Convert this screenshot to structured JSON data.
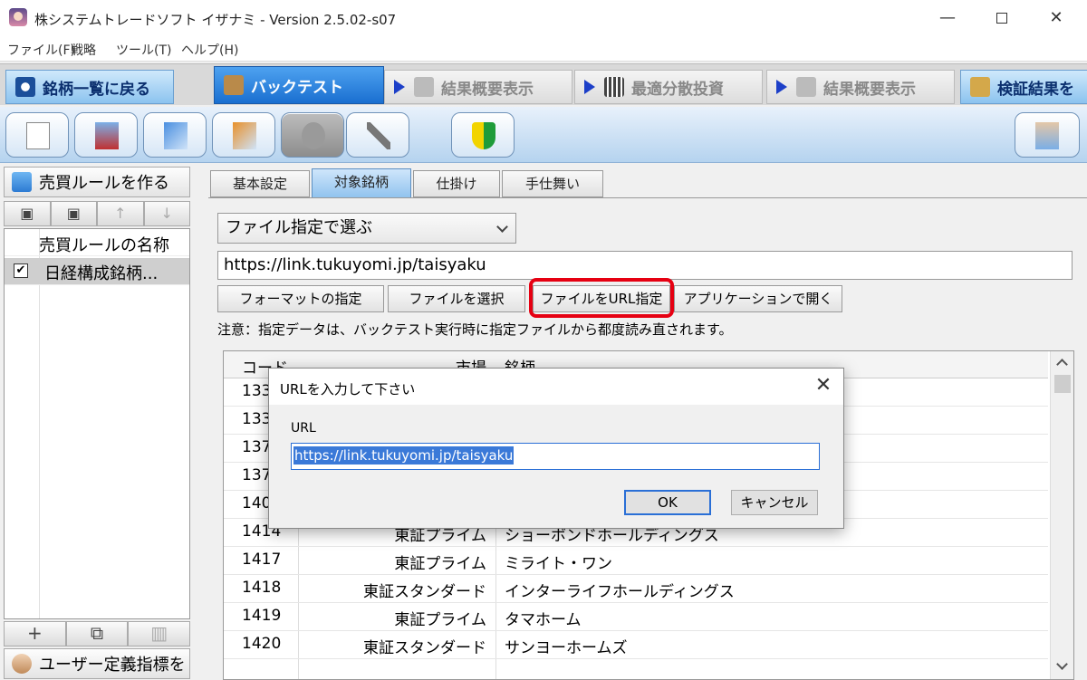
{
  "window": {
    "title": "株システムトレードソフト イザナミ - Version 2.5.02-s07",
    "min": "—",
    "close": "✕"
  },
  "menu": [
    "ファイル(F)",
    "戦略",
    "ツール(T)",
    "ヘルプ(H)"
  ],
  "main_tabs": [
    "銘柄一覧に戻る",
    "バックテスト",
    "結果概要表示",
    "最適分散投資",
    "結果概要表示",
    "検証結果を"
  ],
  "left_panel": {
    "make_rule_label": "売買ルールを作る",
    "table_header": "売買ルールの名称",
    "rules": [
      {
        "checked": "✔",
        "name": "日経構成銘柄..."
      }
    ],
    "user_indicator_label": "ユーザー定義指標を",
    "add_symbol": "+",
    "up_symbol": "↑",
    "down_symbol": "↓"
  },
  "sub_tabs": [
    "基本設定",
    "対象銘柄",
    "仕掛け",
    "手仕舞い"
  ],
  "selector": {
    "value": "ファイル指定で選ぶ"
  },
  "url_field": {
    "value": "https://link.tukuyomi.jp/taisyaku"
  },
  "action_buttons": [
    "フォーマットの指定",
    "ファイルを選択",
    "ファイルをURL指定",
    "アプリケーションで開く"
  ],
  "note": "注意：指定データは、バックテスト実行時に指定ファイルから都度読み直されます。",
  "grid": {
    "headers": {
      "code": "コード",
      "market": "市場",
      "name": "銘柄"
    },
    "rows": [
      {
        "code": "133",
        "market": "",
        "name": ""
      },
      {
        "code": "133",
        "market": "",
        "name": ""
      },
      {
        "code": "137",
        "market": "",
        "name": ""
      },
      {
        "code": "137",
        "market": "",
        "name": ""
      },
      {
        "code": "140",
        "market": "",
        "name": ""
      },
      {
        "code": "1414",
        "market": "東証プライム",
        "name": "ショーボンドホールディングス"
      },
      {
        "code": "1417",
        "market": "東証プライム",
        "name": "ミライト・ワン"
      },
      {
        "code": "1418",
        "market": "東証スタンダード",
        "name": "インターライフホールディングス"
      },
      {
        "code": "1419",
        "market": "東証プライム",
        "name": "タマホーム"
      },
      {
        "code": "1420",
        "market": "東証スタンダード",
        "name": "サンヨーホームズ"
      }
    ]
  },
  "dialog": {
    "title": "URLを入力して下さい",
    "close": "✕",
    "label": "URL",
    "value": "https://link.tukuyomi.jp/taisyaku",
    "ok": "OK",
    "cancel": "キャンセル"
  }
}
